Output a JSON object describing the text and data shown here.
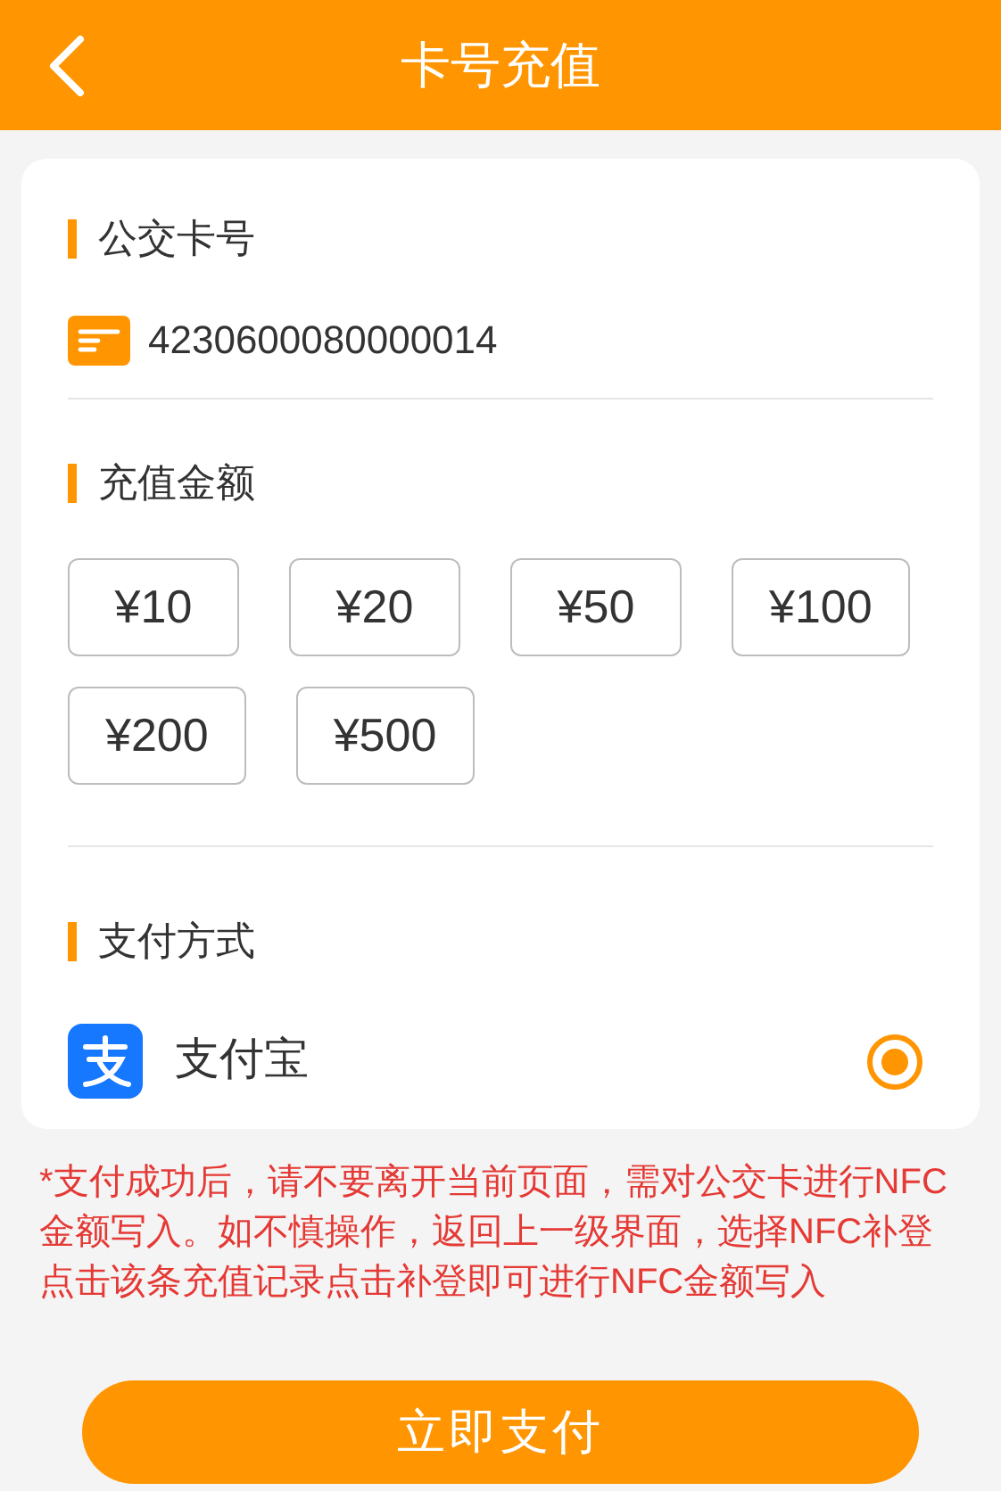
{
  "header": {
    "title": "卡号充值"
  },
  "card_section": {
    "title": "公交卡号",
    "card_number": "4230600080000014"
  },
  "amount_section": {
    "title": "充值金额",
    "amounts": [
      {
        "label": "¥10",
        "selected": false
      },
      {
        "label": "¥20",
        "selected": false
      },
      {
        "label": "¥50",
        "selected": false
      },
      {
        "label": "¥100",
        "selected": false
      },
      {
        "label": "¥200",
        "selected": false
      },
      {
        "label": "¥500",
        "selected": false
      }
    ]
  },
  "payment_section": {
    "title": "支付方式",
    "methods": [
      {
        "label": "支付宝",
        "selected": true
      }
    ]
  },
  "notice": "*支付成功后，请不要离开当前页面，需对公交卡进行NFC金额写入。如不慎操作，返回上一级界面，选择NFC补登点击该条充值记录点击补登即可进行NFC金额写入",
  "pay_button": "立即支付"
}
